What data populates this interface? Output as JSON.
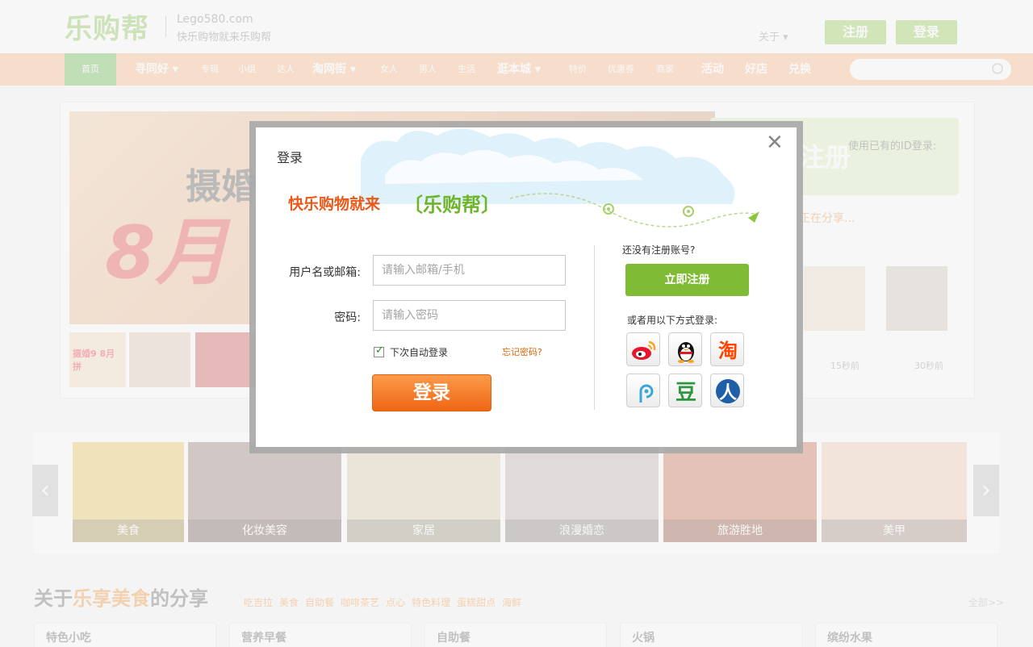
{
  "header": {
    "logo_text": "乐购帮",
    "domain": "Lego580.com",
    "slogan": "快乐购物就来乐购帮",
    "about": "关于",
    "register_label": "注册",
    "login_label": "登录"
  },
  "nav": {
    "items": [
      {
        "label": "首页",
        "kind": "home"
      },
      {
        "label": "寻同好",
        "kind": "big"
      },
      {
        "label": "专辑",
        "kind": "small"
      },
      {
        "label": "小组",
        "kind": "small"
      },
      {
        "label": "达人",
        "kind": "small"
      },
      {
        "label": "淘网街",
        "kind": "big"
      },
      {
        "label": "女人",
        "kind": "small"
      },
      {
        "label": "男人",
        "kind": "small"
      },
      {
        "label": "生活",
        "kind": "small"
      },
      {
        "label": "逛本城",
        "kind": "big"
      },
      {
        "label": "特价",
        "kind": "small"
      },
      {
        "label": "优惠券",
        "kind": "small"
      },
      {
        "label": "商家",
        "kind": "small"
      },
      {
        "label": "活动",
        "kind": "big"
      },
      {
        "label": "好店",
        "kind": "big"
      },
      {
        "label": "兑换",
        "kind": "big"
      }
    ]
  },
  "background": {
    "banner_title": "摄婚",
    "banner_big": "8月",
    "thumb_caption": "摄婚9 8月拼",
    "side_register": "注册",
    "side_hint": "使用已有的ID登录:",
    "side_sharing": "正在分享...",
    "ago_1": "15秒前",
    "ago_2": "30秒前"
  },
  "categories": [
    {
      "label": "美食"
    },
    {
      "label": "化妆美容"
    },
    {
      "label": "家居"
    },
    {
      "label": "浪漫婚恋"
    },
    {
      "label": "旅游胜地"
    },
    {
      "label": "美甲"
    }
  ],
  "section": {
    "title_pre": "关于",
    "title_hl": "乐享美食",
    "title_post": "的分享",
    "tags": [
      "吃吉拉",
      "美食",
      "自助餐",
      "咖啡茶艺",
      "点心",
      "特色料理",
      "蛋糕甜点",
      "海鲜"
    ],
    "all_link": "全部>>",
    "cards": [
      "特色小吃",
      "营养早餐",
      "自助餐",
      "火锅",
      "缤纷水果"
    ]
  },
  "modal": {
    "title": "登录",
    "slogan_left": "快乐购物就来",
    "slogan_right": "〔乐购帮〕",
    "username_label": "用户名或邮箱:",
    "username_placeholder": "请输入邮箱/手机",
    "password_label": "密码:",
    "password_placeholder": "请输入密码",
    "remember_label": "下次自动登录",
    "remember_checked": true,
    "forgot_label": "忘记密码?",
    "login_button": "登录",
    "no_account": "还没有注册账号?",
    "register_now": "立即注册",
    "other_login": "或者用以下方式登录:",
    "social": [
      {
        "name": "weibo-icon",
        "color": "#e6162d"
      },
      {
        "name": "qq-icon",
        "color": "#111111"
      },
      {
        "name": "taobao-icon",
        "color": "#ff4400",
        "glyph": "淘"
      },
      {
        "name": "tencent-weibo-icon",
        "color": "#3aa7d8"
      },
      {
        "name": "douban-icon",
        "color": "#2e963d",
        "glyph": "豆"
      },
      {
        "name": "renren-icon",
        "color": "#1f5fa8",
        "glyph": "人"
      }
    ]
  }
}
